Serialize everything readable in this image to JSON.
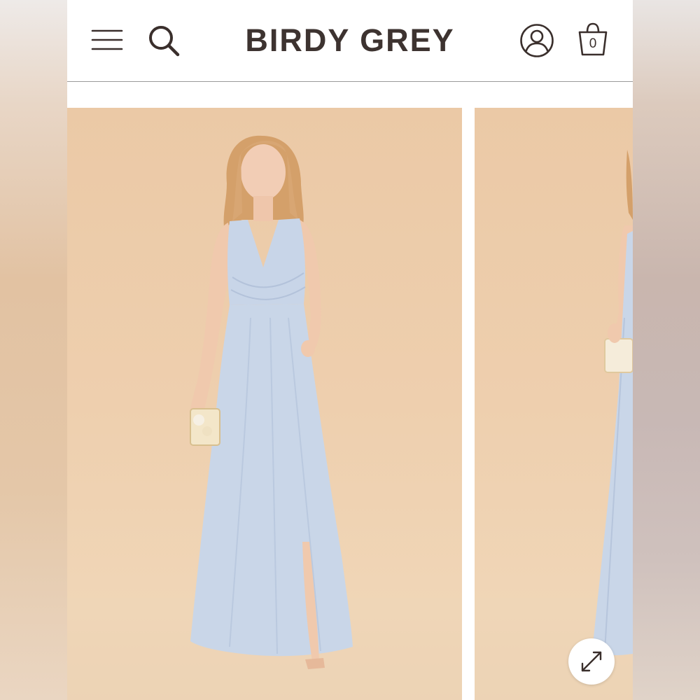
{
  "header": {
    "brand": "BIRDY GREY",
    "bag_count": "0",
    "icons": {
      "menu": "hamburger-menu-icon",
      "search": "search-icon",
      "account": "user-account-icon",
      "bag": "shopping-bag-icon"
    }
  },
  "gallery": {
    "slides": [
      {
        "description_icon": "product-photo",
        "dress_color": "#c9d6e8",
        "backdrop_color": "#eecfae"
      },
      {
        "description_icon": "product-photo",
        "dress_color": "#c9d6e8",
        "backdrop_color": "#eecfae"
      }
    ],
    "expand_icon": "expand-arrows-icon"
  },
  "colors": {
    "brand_text": "#3d3330",
    "icon_stroke": "#3a2f2c",
    "backdrop": "#eecfae",
    "dress": "#c9d6e8"
  }
}
